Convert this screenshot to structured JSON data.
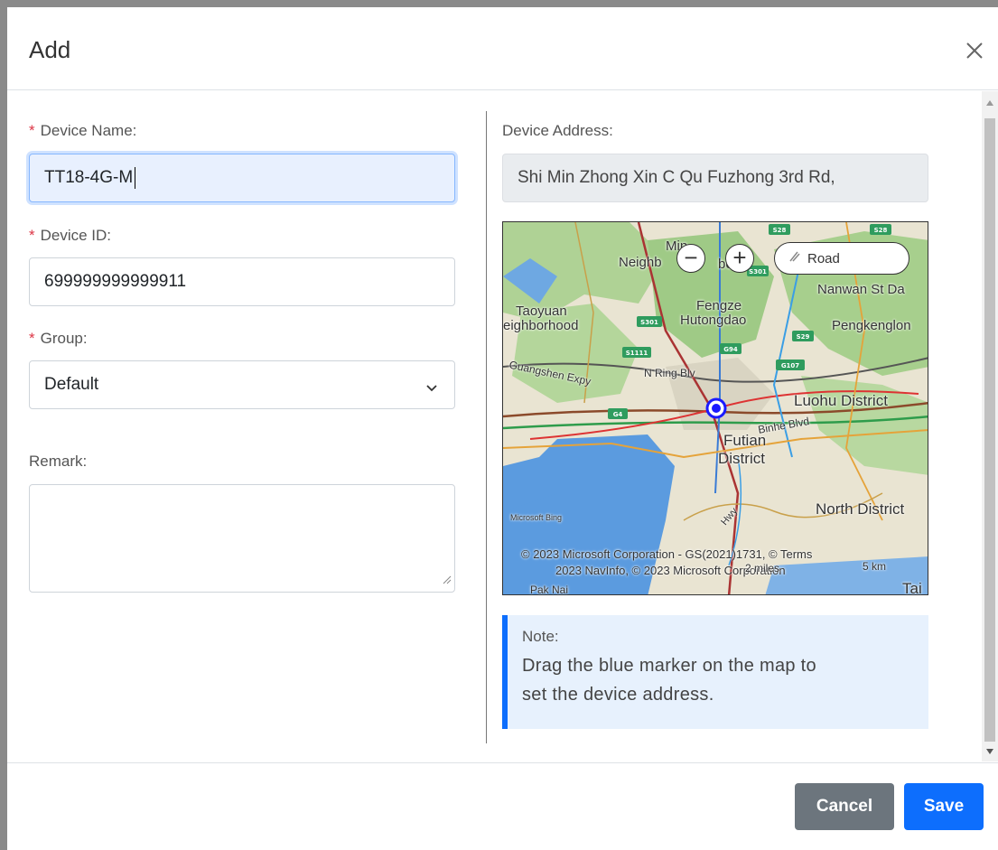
{
  "modal": {
    "title": "Add"
  },
  "form": {
    "device_name": {
      "label": "Device Name:",
      "value": "TT18-4G-M"
    },
    "device_id": {
      "label": "Device ID:",
      "value": "699999999999911"
    },
    "group": {
      "label": "Group:",
      "selected": "Default"
    },
    "remark": {
      "label": "Remark:",
      "value": ""
    },
    "required_mark": "*"
  },
  "address": {
    "label": "Device Address:",
    "value": "Shi Min Zhong Xin C Qu Fuzhong 3rd Rd,"
  },
  "map": {
    "zoom_out": "−",
    "zoom_in": "+",
    "style_button": "Road",
    "labels": {
      "neigh": "Min",
      "neigh2": "Neighb",
      "neigh3": "bo",
      "nanwan": "Nanwan St Da",
      "taoyuan": "Taoyuan",
      "taoyuan2": "eighborhood",
      "fengze": "Fengze",
      "hutong": "Hutongdao",
      "pengkeng": "Pengkenglon",
      "guangshen": "Guangshen Expy",
      "nring": "N Ring Blv",
      "luohu": "Luohu District",
      "futian": "Futian",
      "futian2": "District",
      "binhe": "Binhe Blvd",
      "north": "North District",
      "hwy": "Hwy",
      "bing": "Microsoft Bing",
      "taipo": "Tai",
      "paknai": "Pak Nai"
    },
    "shields": [
      "S28",
      "S28",
      "S301",
      "S301",
      "G94",
      "S29",
      "S1111",
      "G107",
      "G4"
    ],
    "attribution_1": "© 2023 Microsoft Corporation - GS(2021)1731, © Terms",
    "attribution_2": "2023 NavInfo, © 2023 Microsoft Corporation",
    "scale_miles": "2 miles",
    "scale_km": "5 km"
  },
  "note": {
    "title": "Note:",
    "line1": "Drag the blue marker on the map to",
    "line2": "set the device address."
  },
  "footer": {
    "cancel": "Cancel",
    "save": "Save"
  },
  "colors": {
    "primary": "#0d6efd",
    "secondary": "#6c757d",
    "required": "#dc3545",
    "note_bg": "#e7f1fd"
  }
}
